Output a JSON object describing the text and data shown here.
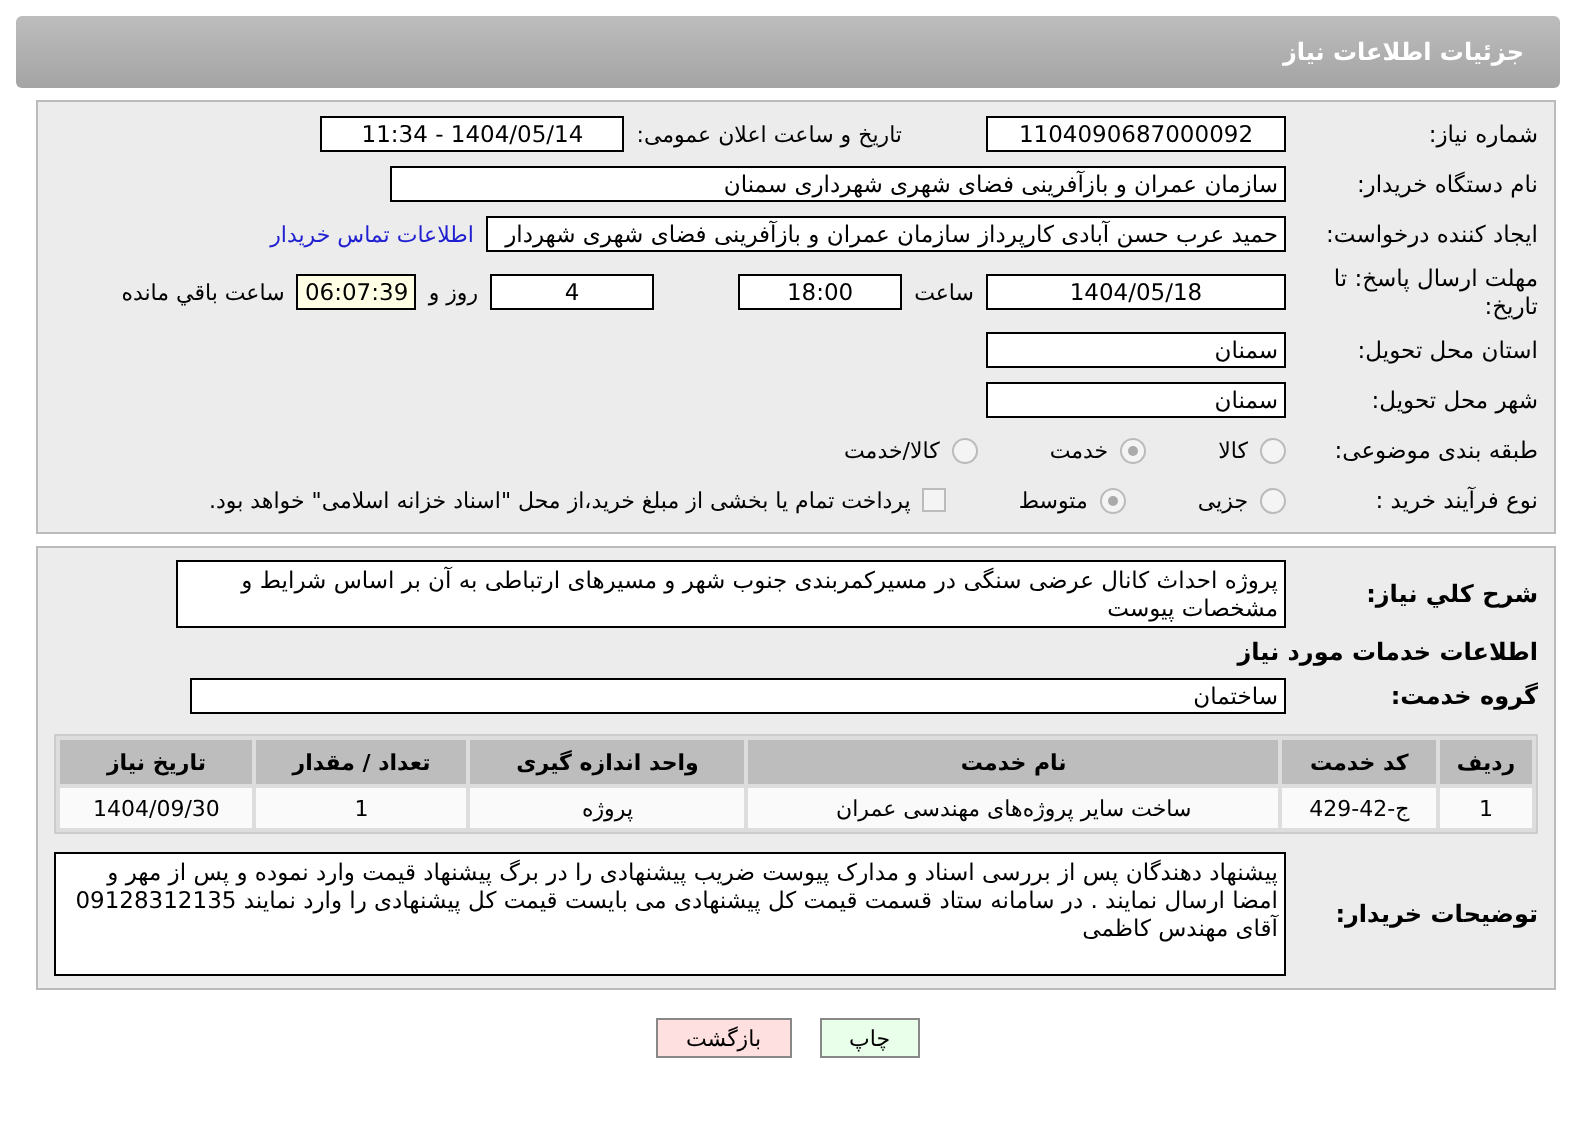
{
  "header": {
    "title": "جزئیات اطلاعات نیاز"
  },
  "need_number": {
    "label": "شماره نیاز:",
    "value": "1104090687000092"
  },
  "announcement": {
    "label": "تاریخ و ساعت اعلان عمومی:",
    "value": "1404/05/14 - 11:34"
  },
  "buyer_org": {
    "label": "نام دستگاه خریدار:",
    "value": "سازمان عمران و بازآفرینی فضای شهری شهرداری سمنان"
  },
  "requester": {
    "label": "ایجاد کننده درخواست:",
    "value": "حمید عرب حسن آبادی کارپرداز سازمان عمران و بازآفرینی فضای شهری شهردار",
    "contact_link": "اطلاعات تماس خریدار"
  },
  "deadline": {
    "label": "مهلت ارسال پاسخ: تا تاریخ:",
    "date": "1404/05/18",
    "time_label": "ساعت",
    "time": "18:00",
    "days": "4",
    "days_label": "روز و",
    "remaining": "06:07:39",
    "remaining_label": "ساعت باقي مانده"
  },
  "province": {
    "label": "استان محل تحویل:",
    "value": "سمنان"
  },
  "city": {
    "label": "شهر محل تحویل:",
    "value": "سمنان"
  },
  "category": {
    "label": "طبقه بندی موضوعی:",
    "options": [
      {
        "label": "کالا",
        "selected": false
      },
      {
        "label": "خدمت",
        "selected": true
      },
      {
        "label": "کالا/خدمت",
        "selected": false
      }
    ]
  },
  "process": {
    "label": "نوع فرآیند خرید :",
    "options": [
      {
        "label": "جزیی",
        "selected": false
      },
      {
        "label": "متوسط",
        "selected": true
      }
    ],
    "payment": {
      "checked": false,
      "label": "پرداخت تمام یا بخشی از مبلغ خرید،از محل \"اسناد خزانه اسلامی\" خواهد بود."
    }
  },
  "description": {
    "label": "شرح کلي نياز:",
    "value": "پروژه احداث کانال عرضی سنگی در مسیرکمربندی جنوب شهر و مسیرهای ارتباطی به آن بر اساس شرایط و مشخصات پیوست"
  },
  "services_title": "اطلاعات خدمات مورد نیاز",
  "service_group": {
    "label": "گروه خدمت:",
    "value": "ساختمان"
  },
  "table": {
    "columns": [
      "ردیف",
      "کد خدمت",
      "نام خدمت",
      "واحد اندازه گیری",
      "تعداد / مقدار",
      "تاریخ نیاز"
    ],
    "rows": [
      [
        "1",
        "ج-42-429",
        "ساخت سایر پروژه‌های مهندسی عمران",
        "پروژه",
        "1",
        "1404/09/30"
      ]
    ]
  },
  "buyer_notes": {
    "label": "توضیحات خریدار:",
    "value": "پیشنهاد دهندگان پس از بررسی اسناد و مدارک پیوست ضریب پیشنهادی را در برگ پیشنهاد قیمت وارد نموده و پس از مهر و امضا ارسال نمایند . در سامانه ستاد قسمت قیمت کل پیشنهادی می بایست قیمت کل پیشنهادی را وارد نمایند 09128312135 آقای مهندس کاظمی"
  },
  "buttons": [
    {
      "label": "چاپ",
      "kind": "print"
    },
    {
      "label": "بازگشت",
      "kind": "back"
    }
  ]
}
